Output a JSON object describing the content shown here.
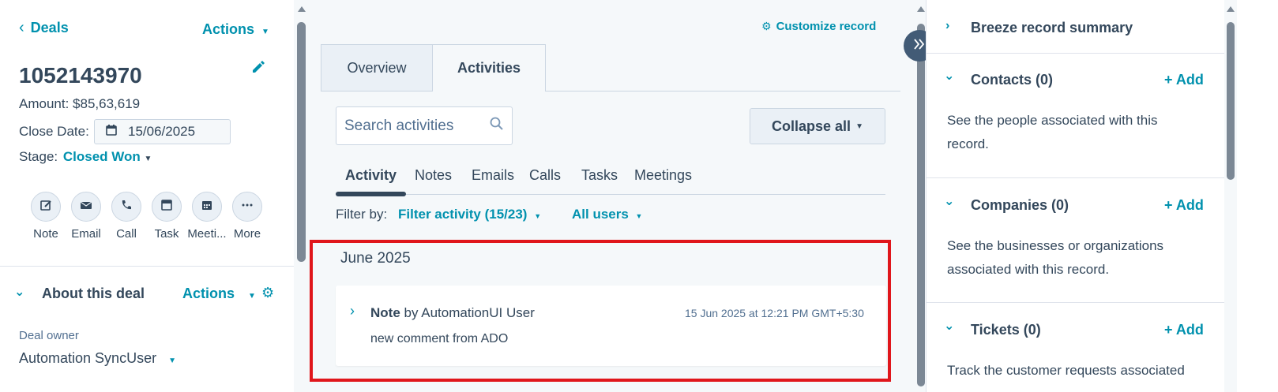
{
  "left": {
    "back_label": "Deals",
    "actions_label": "Actions",
    "record_name": "1052143970",
    "amount": "Amount: $85,63,619",
    "close_date_label": "Close Date:",
    "close_date_value": "15/06/2025",
    "stage_label": "Stage:",
    "stage_value": "Closed Won",
    "activity_buttons": [
      {
        "label": "Note",
        "icon": "note-icon"
      },
      {
        "label": "Email",
        "icon": "email-icon"
      },
      {
        "label": "Call",
        "icon": "phone-icon"
      },
      {
        "label": "Task",
        "icon": "task-icon"
      },
      {
        "label": "Meeti...",
        "icon": "calendar-icon"
      },
      {
        "label": "More",
        "icon": "more-icon"
      }
    ],
    "about_title": "About this deal",
    "about_actions": "Actions",
    "deal_owner_label": "Deal owner",
    "deal_owner_value": "Automation SyncUser"
  },
  "middle": {
    "customize_label": "Customize record",
    "tabs": [
      "Overview",
      "Activities"
    ],
    "active_tab": "Activities",
    "search_placeholder": "Search activities",
    "collapse_label": "Collapse all",
    "sub_tabs": [
      "Activity",
      "Notes",
      "Emails",
      "Calls",
      "Tasks",
      "Meetings"
    ],
    "active_sub_tab": "Activity",
    "filter_by_label": "Filter by:",
    "filter_activity": "Filter activity (15/23)",
    "all_users": "All users",
    "month_header": "June 2025",
    "note": {
      "type": "Note",
      "by_text": "by AutomationUI User",
      "timestamp": "15 Jun 2025 at 12:21 PM GMT+5:30",
      "body": "new comment from ADO"
    }
  },
  "right": {
    "breeze_title": "Breeze record summary",
    "sections": [
      {
        "title": "Contacts (0)",
        "add": "+ Add",
        "text": "See the people associated with this record."
      },
      {
        "title": "Companies (0)",
        "add": "+ Add",
        "text": "See the businesses or organizations associated with this record."
      },
      {
        "title": "Tickets (0)",
        "add": "+ Add",
        "text": "Track the customer requests associated"
      }
    ]
  },
  "colors": {
    "accent": "#0091ae",
    "text": "#33475b",
    "highlight_border": "#e0161b",
    "panel_bg": "#f5f8fa"
  }
}
